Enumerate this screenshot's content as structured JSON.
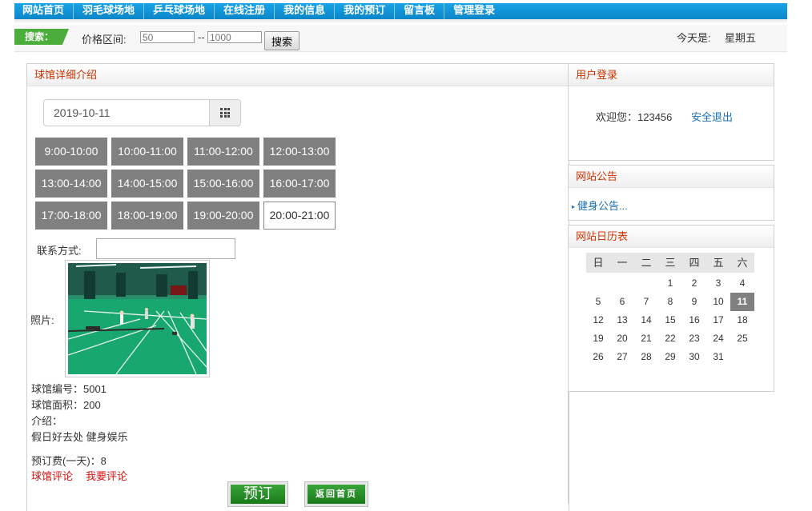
{
  "nav": {
    "items": [
      "网站首页",
      "羽毛球场地",
      "乒乓球场地",
      "在线注册",
      "我的信息",
      "我的预订",
      "留言板",
      "管理登录"
    ]
  },
  "search": {
    "tag": "搜索：",
    "price_label": "价格区间:",
    "min_placeholder": "50",
    "dash": "--",
    "max_placeholder": "1000",
    "button": "搜索"
  },
  "today": {
    "label": "今天是:",
    "value": "星期五"
  },
  "main": {
    "title": "球馆详细介绍",
    "date": "2019-10-11",
    "slots": [
      {
        "label": "9:00-10:00",
        "available": false
      },
      {
        "label": "10:00-11:00",
        "available": false
      },
      {
        "label": "11:00-12:00",
        "available": false
      },
      {
        "label": "12:00-13:00",
        "available": false
      },
      {
        "label": "13:00-14:00",
        "available": false
      },
      {
        "label": "14:00-15:00",
        "available": false
      },
      {
        "label": "15:00-16:00",
        "available": false
      },
      {
        "label": "16:00-17:00",
        "available": false
      },
      {
        "label": "17:00-18:00",
        "available": false
      },
      {
        "label": "18:00-19:00",
        "available": false
      },
      {
        "label": "19:00-20:00",
        "available": false
      },
      {
        "label": "20:00-21:00",
        "available": true
      }
    ],
    "contact_label": "联系方式:",
    "contact_value": "",
    "photo_label": "照片:",
    "venue_number": "球馆编号：5001",
    "venue_area": "球馆面积：200",
    "intro_label": "介绍：",
    "intro_text": "假日好去处 健身娱乐",
    "fee": "预订费(一天)：8",
    "review_link": "球馆评论",
    "write_review_link": "我要评论",
    "book_button": "预订",
    "home_button": "返回首页"
  },
  "login": {
    "title": "用户登录",
    "welcome": "欢迎您：123456",
    "logout": "安全退出"
  },
  "notice": {
    "title": "网站公告",
    "items": [
      "健身公告..."
    ]
  },
  "calendar": {
    "title": "网站日历表",
    "weekdays": [
      "日",
      "一",
      "二",
      "三",
      "四",
      "五",
      "六"
    ],
    "days": [
      "",
      "",
      "",
      "1",
      "2",
      "3",
      "4",
      "5",
      "6",
      "7",
      "8",
      "9",
      "10",
      "11",
      "12",
      "13",
      "14",
      "15",
      "16",
      "17",
      "18",
      "19",
      "20",
      "21",
      "22",
      "23",
      "24",
      "25",
      "26",
      "27",
      "28",
      "29",
      "30",
      "31"
    ],
    "today": "11"
  }
}
